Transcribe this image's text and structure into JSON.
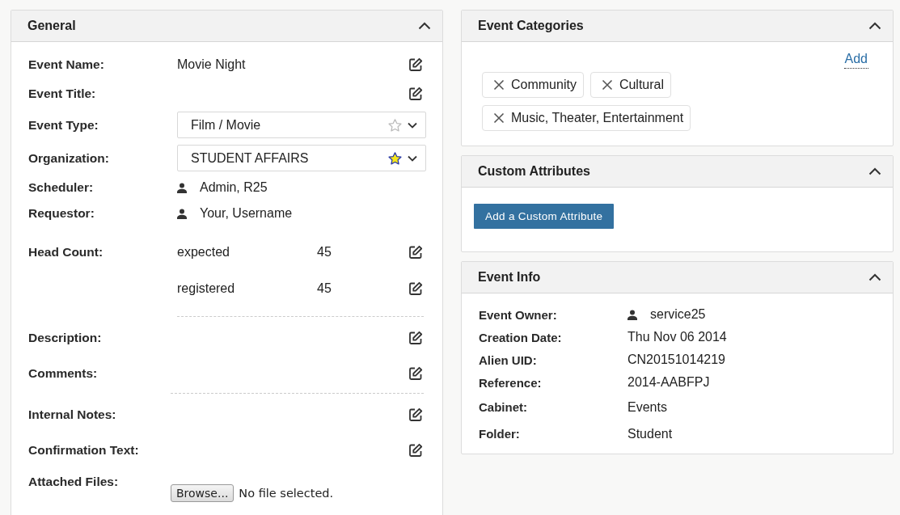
{
  "general": {
    "title": "General",
    "expanded": true,
    "fields": [
      {
        "kind": "text",
        "label": "Event Name:",
        "value": "Movie Night",
        "editable": true
      },
      {
        "kind": "text",
        "label": "Event Title:",
        "editable": true
      },
      {
        "kind": "select",
        "label": "Event Type:",
        "value": "Film / Movie",
        "favorite": false
      },
      {
        "kind": "select",
        "label": "Organization:",
        "value": "STUDENT AFFAIRS",
        "favorite": true
      },
      {
        "kind": "person",
        "label": "Scheduler:",
        "value": "Admin, R25"
      },
      {
        "kind": "person",
        "label": "Requestor:",
        "value": "Your, Username"
      },
      {
        "kind": "headcount",
        "label": "Head Count:",
        "counts": [
          {
            "name": "expected",
            "value": "45",
            "editable": true
          },
          {
            "name": "registered",
            "value": "45",
            "editable": true
          }
        ]
      },
      {
        "kind": "divider"
      },
      {
        "kind": "note",
        "label": "Description:",
        "editable": true
      },
      {
        "kind": "note",
        "label": "Comments:",
        "editable": true
      },
      {
        "kind": "divider"
      },
      {
        "kind": "note",
        "label": "Internal Notes:",
        "editable": true
      },
      {
        "kind": "note",
        "label": "Confirmation Text:",
        "editable": true
      },
      {
        "kind": "file",
        "label": "Attached Files:",
        "button": "Browse...",
        "status": "No file selected."
      }
    ]
  },
  "categories": {
    "title": "Event Categories",
    "expanded": true,
    "add_link": "Add",
    "tags": [
      "Community",
      "Cultural",
      "Music, Theater, Entertainment"
    ]
  },
  "custom_attributes": {
    "title": "Custom Attributes",
    "expanded": true,
    "button": "Add a Custom Attribute"
  },
  "event_info": {
    "title": "Event Info",
    "expanded": true,
    "fields": [
      {
        "kind": "person",
        "label": "Event Owner:",
        "value": "service25"
      },
      {
        "kind": "text",
        "label": "Creation Date:",
        "value": "Thu Nov 06 2014"
      },
      {
        "kind": "text",
        "label": "Alien UID:",
        "value": "CN20151014219"
      },
      {
        "kind": "text",
        "label": "Reference:",
        "value": "2014-AABFPJ"
      },
      {
        "kind": "text",
        "label": "Cabinet:",
        "value": "Events"
      },
      {
        "kind": "text",
        "label": "Folder:",
        "value": "Student"
      }
    ]
  }
}
